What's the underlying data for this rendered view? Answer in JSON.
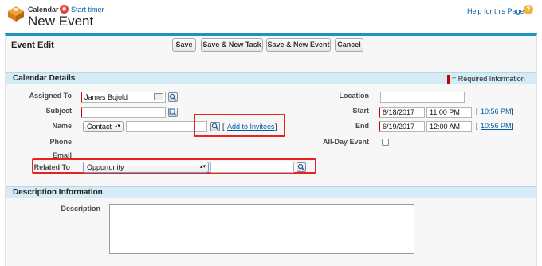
{
  "header": {
    "app_label": "Calendar",
    "timer_link": "Start timer",
    "page_title": "New Event",
    "help_link": "Help for this Page",
    "help_icon_glyph": "?"
  },
  "panel": {
    "title": "Event Edit",
    "buttons": {
      "save": "Save",
      "save_new_task": "Save & New Task",
      "save_new_event": "Save & New Event",
      "cancel": "Cancel"
    }
  },
  "calendar_details": {
    "title": "Calendar Details",
    "required_note": "= Required Information",
    "labels": {
      "assigned_to": "Assigned To",
      "subject": "Subject",
      "name": "Name",
      "phone": "Phone",
      "email": "Email",
      "related_to": "Related To",
      "location": "Location",
      "start": "Start",
      "end": "End",
      "all_day": "All-Day Event"
    },
    "values": {
      "assigned_to": "James Bujold",
      "subject": "",
      "name_type": "Contact",
      "name_value": "",
      "related_type": "Opportunity",
      "related_value": "",
      "location": "",
      "start_date": "6/18/2017",
      "start_time": "11:00 PM",
      "start_now": "10:56 PM",
      "end_date": "6/19/2017",
      "end_time": "12:00 AM",
      "end_now": "10:56 PM",
      "all_day_checked": false
    },
    "add_to_invitees": "Add to Invitees",
    "bracket_open": "[",
    "bracket_close": "]"
  },
  "description_info": {
    "title": "Description Information",
    "description_label": "Description",
    "description_value": ""
  },
  "colors": {
    "accent": "#1797c0",
    "section_bg": "#d5ebf5",
    "required": "#cc0000",
    "highlight": "#e8221f",
    "link": "#015ba7"
  }
}
